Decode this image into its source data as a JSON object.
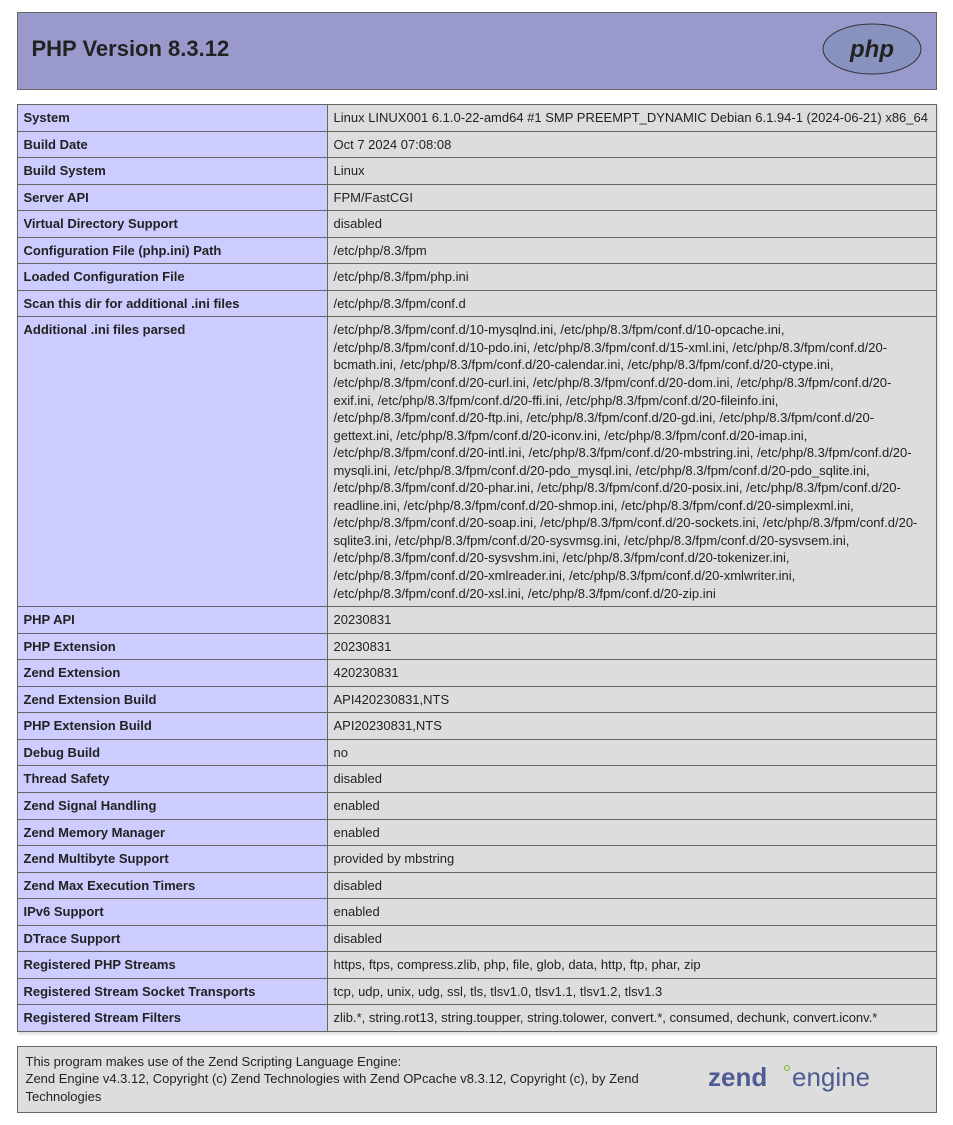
{
  "header": {
    "title": "PHP Version 8.3.12"
  },
  "rows": [
    {
      "label": "System",
      "value": "Linux LINUX001 6.1.0-22-amd64 #1 SMP PREEMPT_DYNAMIC Debian 6.1.94-1 (2024-06-21) x86_64"
    },
    {
      "label": "Build Date",
      "value": "Oct 7 2024 07:08:08"
    },
    {
      "label": "Build System",
      "value": "Linux"
    },
    {
      "label": "Server API",
      "value": "FPM/FastCGI"
    },
    {
      "label": "Virtual Directory Support",
      "value": "disabled"
    },
    {
      "label": "Configuration File (php.ini) Path",
      "value": "/etc/php/8.3/fpm"
    },
    {
      "label": "Loaded Configuration File",
      "value": "/etc/php/8.3/fpm/php.ini"
    },
    {
      "label": "Scan this dir for additional .ini files",
      "value": "/etc/php/8.3/fpm/conf.d"
    },
    {
      "label": "Additional .ini files parsed",
      "value": "/etc/php/8.3/fpm/conf.d/10-mysqlnd.ini, /etc/php/8.3/fpm/conf.d/10-opcache.ini, /etc/php/8.3/fpm/conf.d/10-pdo.ini, /etc/php/8.3/fpm/conf.d/15-xml.ini, /etc/php/8.3/fpm/conf.d/20-bcmath.ini, /etc/php/8.3/fpm/conf.d/20-calendar.ini, /etc/php/8.3/fpm/conf.d/20-ctype.ini, /etc/php/8.3/fpm/conf.d/20-curl.ini, /etc/php/8.3/fpm/conf.d/20-dom.ini, /etc/php/8.3/fpm/conf.d/20-exif.ini, /etc/php/8.3/fpm/conf.d/20-ffi.ini, /etc/php/8.3/fpm/conf.d/20-fileinfo.ini, /etc/php/8.3/fpm/conf.d/20-ftp.ini, /etc/php/8.3/fpm/conf.d/20-gd.ini, /etc/php/8.3/fpm/conf.d/20-gettext.ini, /etc/php/8.3/fpm/conf.d/20-iconv.ini, /etc/php/8.3/fpm/conf.d/20-imap.ini, /etc/php/8.3/fpm/conf.d/20-intl.ini, /etc/php/8.3/fpm/conf.d/20-mbstring.ini, /etc/php/8.3/fpm/conf.d/20-mysqli.ini, /etc/php/8.3/fpm/conf.d/20-pdo_mysql.ini, /etc/php/8.3/fpm/conf.d/20-pdo_sqlite.ini, /etc/php/8.3/fpm/conf.d/20-phar.ini, /etc/php/8.3/fpm/conf.d/20-posix.ini, /etc/php/8.3/fpm/conf.d/20-readline.ini, /etc/php/8.3/fpm/conf.d/20-shmop.ini, /etc/php/8.3/fpm/conf.d/20-simplexml.ini, /etc/php/8.3/fpm/conf.d/20-soap.ini, /etc/php/8.3/fpm/conf.d/20-sockets.ini, /etc/php/8.3/fpm/conf.d/20-sqlite3.ini, /etc/php/8.3/fpm/conf.d/20-sysvmsg.ini, /etc/php/8.3/fpm/conf.d/20-sysvsem.ini, /etc/php/8.3/fpm/conf.d/20-sysvshm.ini, /etc/php/8.3/fpm/conf.d/20-tokenizer.ini, /etc/php/8.3/fpm/conf.d/20-xmlreader.ini, /etc/php/8.3/fpm/conf.d/20-xmlwriter.ini, /etc/php/8.3/fpm/conf.d/20-xsl.ini, /etc/php/8.3/fpm/conf.d/20-zip.ini"
    },
    {
      "label": "PHP API",
      "value": "20230831"
    },
    {
      "label": "PHP Extension",
      "value": "20230831"
    },
    {
      "label": "Zend Extension",
      "value": "420230831"
    },
    {
      "label": "Zend Extension Build",
      "value": "API420230831,NTS"
    },
    {
      "label": "PHP Extension Build",
      "value": "API20230831,NTS"
    },
    {
      "label": "Debug Build",
      "value": "no"
    },
    {
      "label": "Thread Safety",
      "value": "disabled"
    },
    {
      "label": "Zend Signal Handling",
      "value": "enabled"
    },
    {
      "label": "Zend Memory Manager",
      "value": "enabled"
    },
    {
      "label": "Zend Multibyte Support",
      "value": "provided by mbstring"
    },
    {
      "label": "Zend Max Execution Timers",
      "value": "disabled"
    },
    {
      "label": "IPv6 Support",
      "value": "enabled"
    },
    {
      "label": "DTrace Support",
      "value": "disabled"
    },
    {
      "label": "Registered PHP Streams",
      "value": "https, ftps, compress.zlib, php, file, glob, data, http, ftp, phar, zip"
    },
    {
      "label": "Registered Stream Socket Transports",
      "value": "tcp, udp, unix, udg, ssl, tls, tlsv1.0, tlsv1.1, tlsv1.2, tlsv1.3"
    },
    {
      "label": "Registered Stream Filters",
      "value": "zlib.*, string.rot13, string.toupper, string.tolower, convert.*, consumed, dechunk, convert.iconv.*"
    }
  ],
  "zend": {
    "line1": "This program makes use of the Zend Scripting Language Engine:",
    "line2": "Zend Engine v4.3.12, Copyright (c) Zend Technologies with Zend OPcache v8.3.12, Copyright (c), by Zend Technologies"
  }
}
